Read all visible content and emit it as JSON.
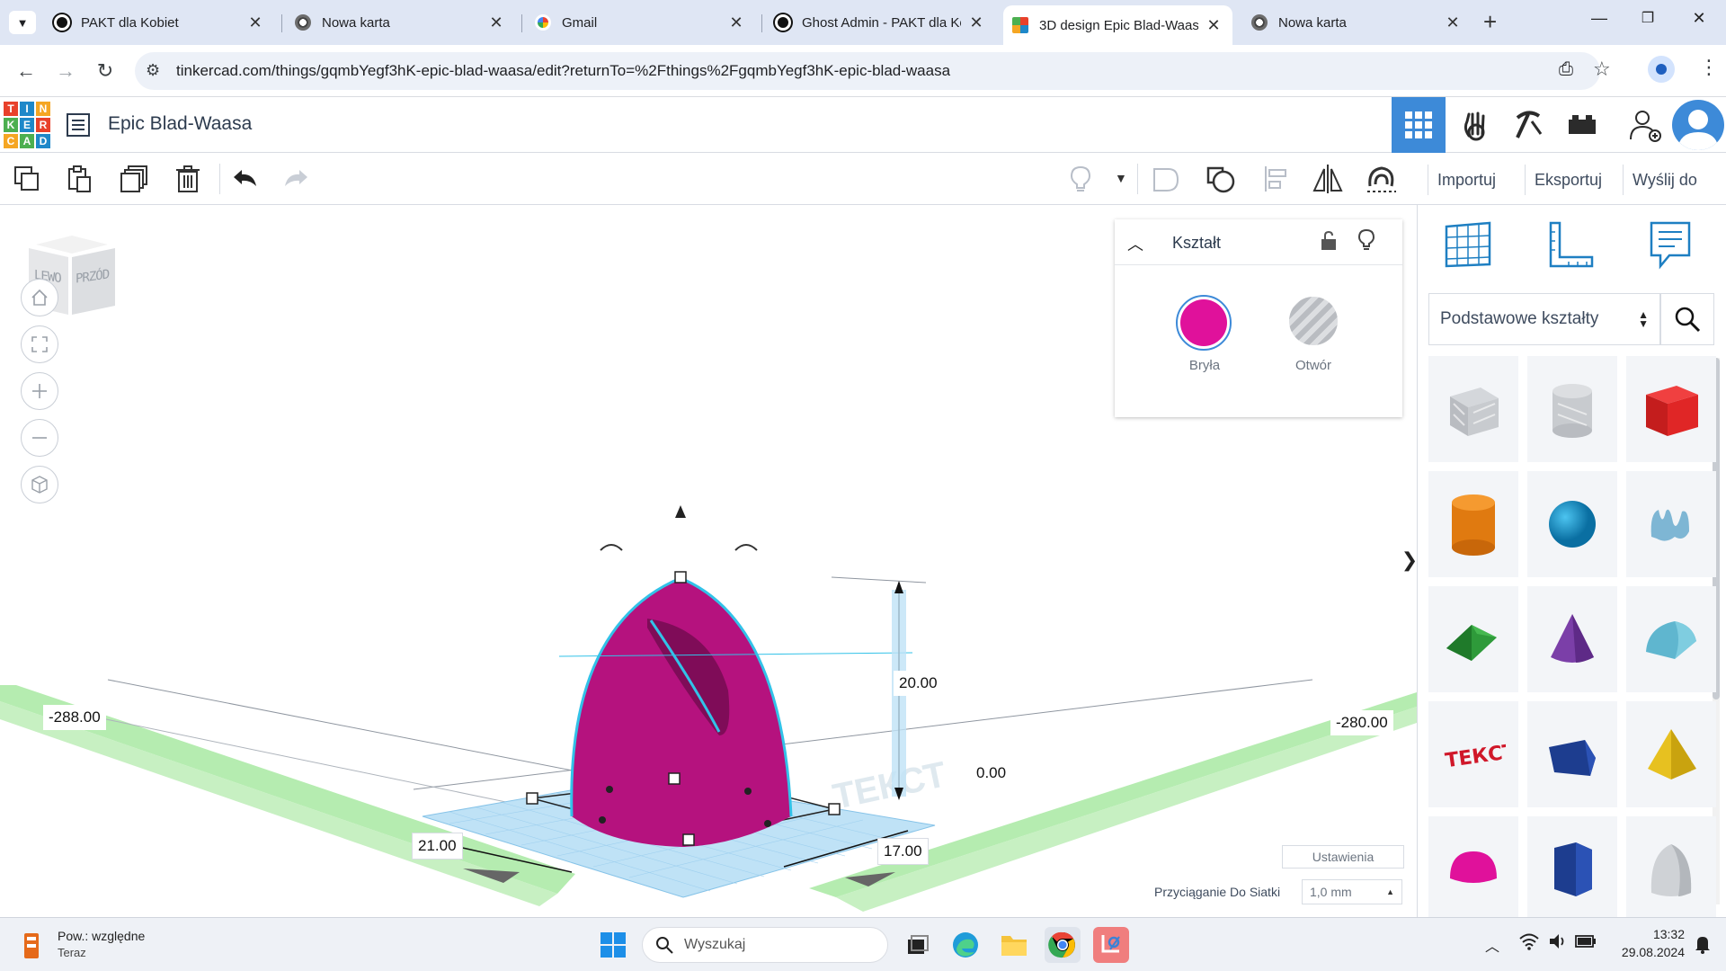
{
  "browser": {
    "tabs": [
      {
        "title": "PAKT dla Kobiet",
        "icon": "circle-dark-icon"
      },
      {
        "title": "Nowa karta",
        "icon": "chrome-icon"
      },
      {
        "title": "Gmail",
        "icon": "google-icon"
      },
      {
        "title": "Ghost Admin - PAKT dla Ko",
        "icon": "circle-dark-icon"
      },
      {
        "title": "3D design Epic Blad-Waasa",
        "icon": "tinkercad-icon",
        "active": true
      },
      {
        "title": "Nowa karta",
        "icon": "chrome-icon"
      }
    ],
    "url": "tinkercad.com/things/gqmbYegf3hK-epic-blad-waasa/edit?returnTo=%2Fthings%2FgqmbYegf3hK-epic-blad-waasa"
  },
  "app": {
    "logo_letters": [
      "T",
      "I",
      "N",
      "K",
      "E",
      "R",
      "C",
      "A",
      "D"
    ],
    "design_title": "Epic Blad-Waasa"
  },
  "toolbar": {
    "import_label": "Importuj",
    "export_label": "Eksportuj",
    "send_label": "Wyślij do"
  },
  "viewcube": {
    "left": "LEWO",
    "front": "PRZÓD"
  },
  "inspector": {
    "title": "Kształt",
    "solid_label": "Bryła",
    "hole_label": "Otwór",
    "solid_color": "#e0119b"
  },
  "viewport": {
    "dims": {
      "height": "20.00",
      "elevation": "0.00",
      "left_coord": "-288.00",
      "right_coord": "-280.00",
      "width": "21.00",
      "depth": "17.00"
    },
    "settings_label": "Ustawienia",
    "snap_label": "Przyciąganie Do Siatki",
    "snap_value": "1,0 mm"
  },
  "shapes_panel": {
    "category": "Podstawowe kształty"
  },
  "taskbar": {
    "weather_title": "Pow.: względne",
    "weather_sub": "Teraz",
    "search_placeholder": "Wyszukaj",
    "time": "13:32",
    "date": "29.08.2024"
  }
}
